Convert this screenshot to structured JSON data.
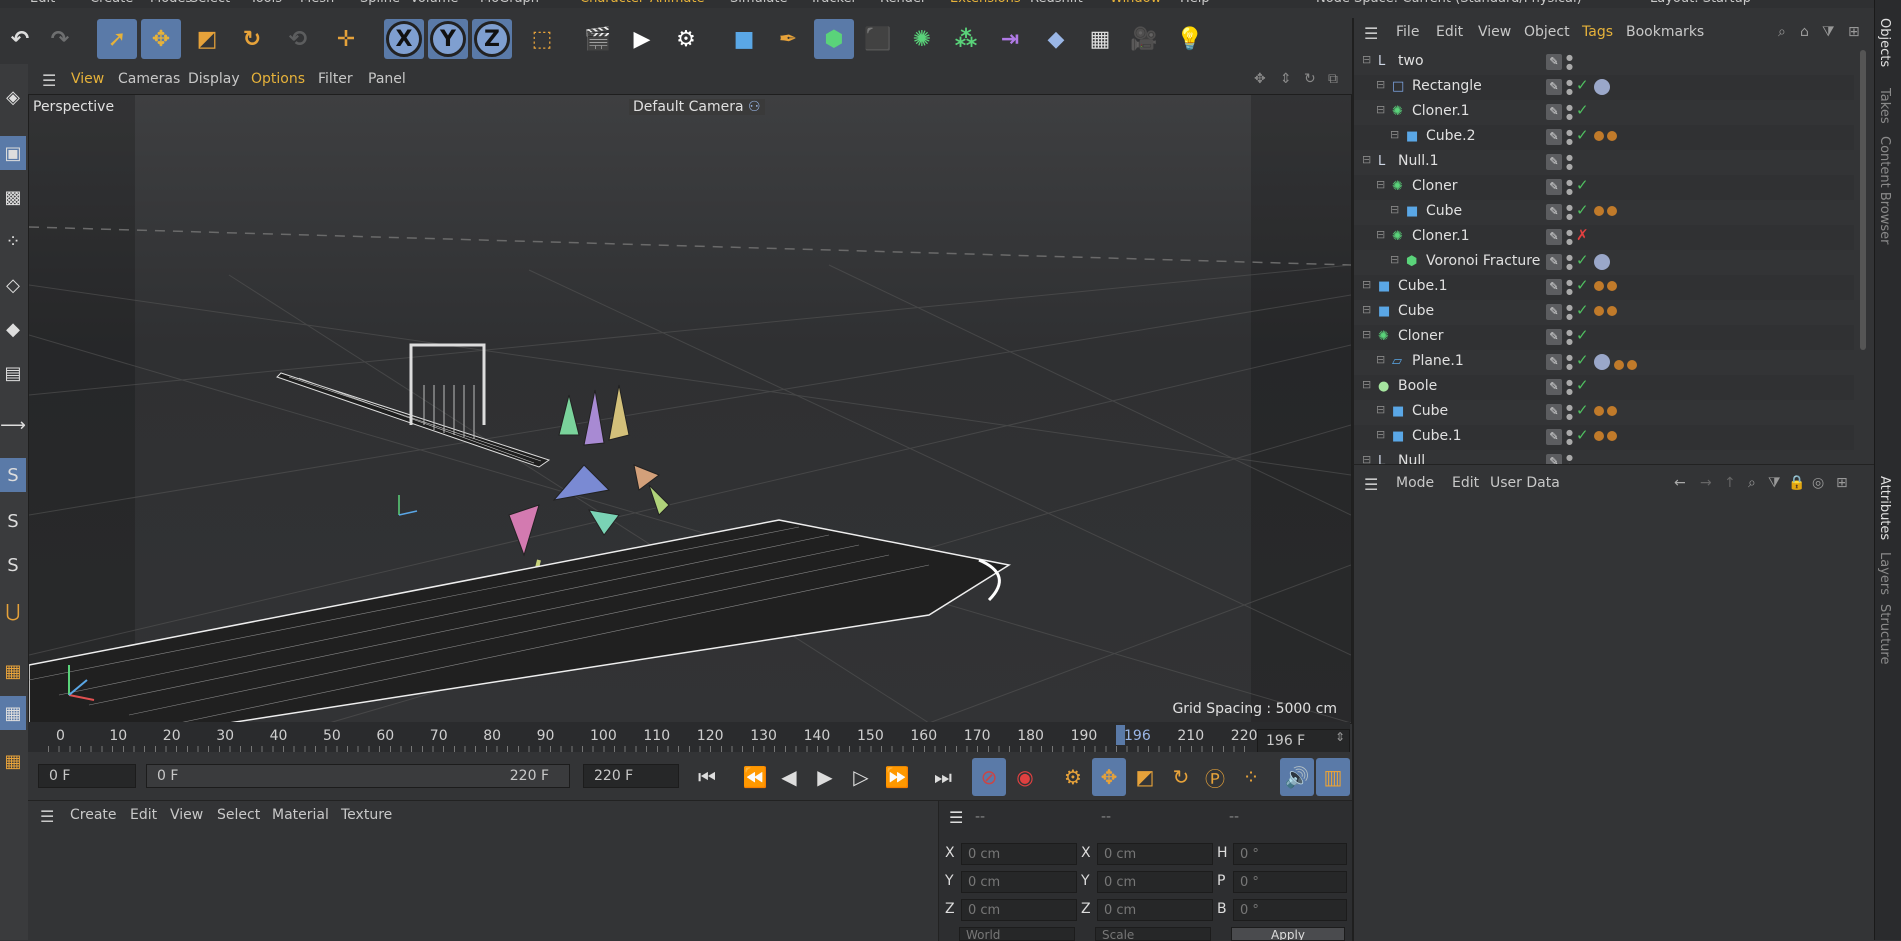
{
  "top_menu": [
    "Edit",
    "Create",
    "Modes",
    "Select",
    "Tools",
    "Mesh",
    "Spline",
    "Volume",
    "MoGraph",
    "Character",
    "Animate",
    "Simulate",
    "Tracker",
    "Render",
    "Extensions",
    "Redshift",
    "Window",
    "Help"
  ],
  "top_menu_highlight": [
    "Character",
    "Animate",
    "Extensions",
    "Window"
  ],
  "node_space": {
    "label": "Node Space:",
    "value": "Current (Standard/Physical)"
  },
  "layout": {
    "label": "Layout:",
    "value": "Startup"
  },
  "viewport": {
    "menu": [
      "View",
      "Cameras",
      "Display",
      "Options",
      "Filter",
      "Panel"
    ],
    "menu_active": [
      "View",
      "Options"
    ],
    "label": "Perspective",
    "camera": "Default Camera",
    "grid_spacing": "Grid Spacing : 5000 cm"
  },
  "timeline": {
    "ticks": [
      "0",
      "10",
      "20",
      "30",
      "40",
      "50",
      "60",
      "70",
      "80",
      "90",
      "100",
      "110",
      "120",
      "130",
      "140",
      "150",
      "160",
      "170",
      "180",
      "190",
      "196",
      "210",
      "220"
    ],
    "current_tick": "196",
    "frame_field": "196 F"
  },
  "transport": {
    "start": "0 F",
    "range_start": "0 F",
    "range_end": "220 F",
    "end": "220 F"
  },
  "material_manager": {
    "menu": [
      "Create",
      "Edit",
      "View",
      "Select",
      "Material",
      "Texture"
    ]
  },
  "coordinates": {
    "headers": [
      "--",
      "--",
      "--"
    ],
    "rows": [
      {
        "a": "X",
        "av": "0 cm",
        "b": "X",
        "bv": "0 cm",
        "c": "H",
        "cv": "0 °"
      },
      {
        "a": "Y",
        "av": "0 cm",
        "b": "Y",
        "bv": "0 cm",
        "c": "P",
        "cv": "0 °"
      },
      {
        "a": "Z",
        "av": "0 cm",
        "b": "Z",
        "bv": "0 cm",
        "c": "B",
        "cv": "0 °"
      }
    ],
    "world": "World",
    "scale": "Scale",
    "apply": "Apply"
  },
  "object_manager": {
    "menu": [
      "File",
      "Edit",
      "View",
      "Object",
      "Tags",
      "Bookmarks"
    ],
    "menu_active": [
      "Tags"
    ],
    "objects": [
      {
        "name": "two",
        "indent": 0,
        "type": "null",
        "check": "",
        "tags": ""
      },
      {
        "name": "Rectangle",
        "indent": 1,
        "type": "spline",
        "check": "✓",
        "tags": "m"
      },
      {
        "name": "Cloner.1",
        "indent": 1,
        "type": "cloner",
        "check": "✓",
        "tags": ""
      },
      {
        "name": "Cube.2",
        "indent": 2,
        "type": "cube",
        "check": "✓",
        "tags": "oo"
      },
      {
        "name": "Null.1",
        "indent": 0,
        "type": "null",
        "check": "",
        "tags": ""
      },
      {
        "name": "Cloner",
        "indent": 1,
        "type": "cloner",
        "check": "✓",
        "tags": ""
      },
      {
        "name": "Cube",
        "indent": 2,
        "type": "cube",
        "check": "✓",
        "tags": "oo"
      },
      {
        "name": "Cloner.1",
        "indent": 1,
        "type": "cloner",
        "check": "✗",
        "tags": ""
      },
      {
        "name": "Voronoi Fracture",
        "indent": 2,
        "type": "voronoi",
        "check": "✓",
        "tags": "m"
      },
      {
        "name": "Cube.1",
        "indent": 0,
        "type": "cube",
        "check": "✓",
        "tags": "oo"
      },
      {
        "name": "Cube",
        "indent": 0,
        "type": "cube",
        "check": "✓",
        "tags": "oo"
      },
      {
        "name": "Cloner",
        "indent": 0,
        "type": "cloner",
        "check": "✓",
        "tags": ""
      },
      {
        "name": "Plane.1",
        "indent": 1,
        "type": "plane",
        "check": "✓",
        "tags": "moo"
      },
      {
        "name": "Boole",
        "indent": 0,
        "type": "boole",
        "check": "✓",
        "tags": ""
      },
      {
        "name": "Cube",
        "indent": 1,
        "type": "cube",
        "check": "✓",
        "tags": "oo"
      },
      {
        "name": "Cube.1",
        "indent": 1,
        "type": "cube",
        "check": "✓",
        "tags": "oo"
      },
      {
        "name": "Null",
        "indent": 0,
        "type": "null",
        "check": "",
        "tags": ""
      }
    ]
  },
  "attributes": {
    "menu": [
      "Mode",
      "Edit",
      "User Data"
    ]
  },
  "right_tabs": [
    "Objects",
    "Takes",
    "Content Browser",
    "Attributes",
    "Layers",
    "Structure"
  ],
  "colors": {
    "accent": "#5a7aa8",
    "highlight": "#e6b23a",
    "check": "#4fc060",
    "cross": "#e04040"
  }
}
